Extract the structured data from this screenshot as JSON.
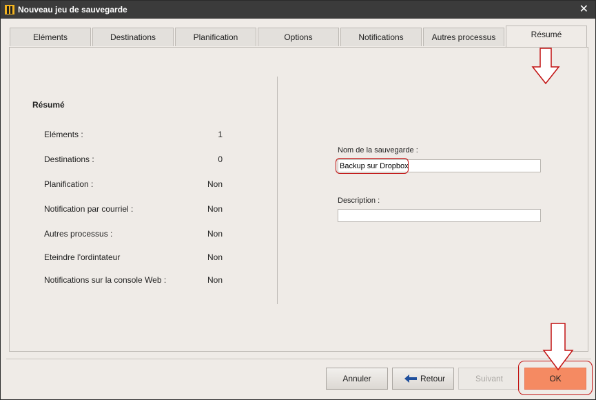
{
  "window": {
    "title": "Nouveau jeu de sauvegarde"
  },
  "tabs": [
    {
      "label": "Eléments"
    },
    {
      "label": "Destinations"
    },
    {
      "label": "Planification"
    },
    {
      "label": "Options"
    },
    {
      "label": "Notifications"
    },
    {
      "label": "Autres processus"
    },
    {
      "label": "Résumé",
      "active": true
    }
  ],
  "summary": {
    "title": "Résumé",
    "rows": [
      {
        "label": "Eléments :",
        "value": "1"
      },
      {
        "label": "Destinations :",
        "value": "0"
      },
      {
        "label": "Planification :",
        "value": "Non"
      },
      {
        "label": "Notification par courriel :",
        "value": "Non"
      },
      {
        "label": "Autres processus :",
        "value": "Non"
      },
      {
        "label": "Eteindre l'ordintateur",
        "value": "Non"
      },
      {
        "label": "Notifications sur la console Web :",
        "value": "Non"
      }
    ]
  },
  "form": {
    "name_label": "Nom de la sauvegarde :",
    "name_value": "Backup sur Dropbox",
    "description_label": "Description :",
    "description_value": ""
  },
  "buttons": {
    "cancel": "Annuler",
    "back": "Retour",
    "next": "Suivant",
    "ok": "OK"
  },
  "colors": {
    "accent_ok": "#f58a62",
    "annotation": "#c21010",
    "titlebar": "#3b3b3b"
  },
  "icons": {
    "app": "app-logo-icon",
    "close": "close-icon",
    "back": "back-arrow-icon"
  }
}
